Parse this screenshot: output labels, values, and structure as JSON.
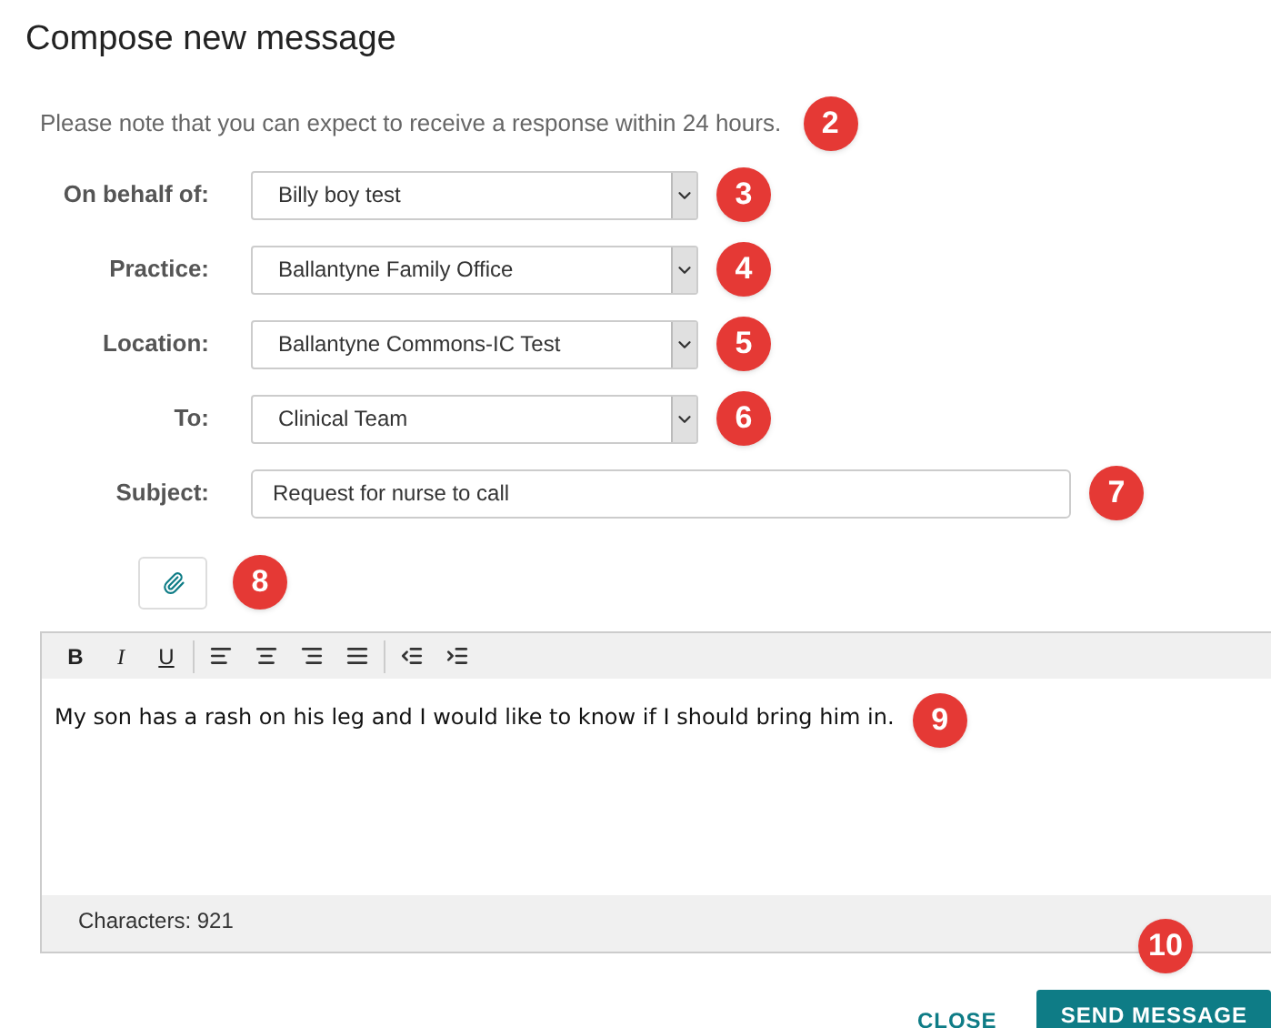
{
  "title": "Compose new message",
  "note": {
    "text": "Please note that you can expect to receive a response within 24 hours.",
    "badge": "2"
  },
  "fields": [
    {
      "kind": "select",
      "label": "On behalf of:",
      "value": "Billy boy test",
      "badge": "3"
    },
    {
      "kind": "select",
      "label": "Practice:",
      "value": "Ballantyne Family Office",
      "badge": "4"
    },
    {
      "kind": "select",
      "label": "Location:",
      "value": "Ballantyne Commons-IC Test",
      "badge": "5"
    },
    {
      "kind": "select",
      "label": "To:",
      "value": "Clinical Team",
      "badge": "6"
    },
    {
      "kind": "text",
      "label": "Subject:",
      "value": "Request for nurse to call",
      "badge": "7"
    }
  ],
  "attach": {
    "badge": "8"
  },
  "toolbar": [
    {
      "kind": "bold",
      "label": "B"
    },
    {
      "kind": "italic",
      "label": "I"
    },
    {
      "kind": "underline",
      "label": "U"
    },
    {
      "kind": "align-left"
    },
    {
      "kind": "align-center"
    },
    {
      "kind": "align-right"
    },
    {
      "kind": "align-justify"
    },
    {
      "kind": "outdent"
    },
    {
      "kind": "indent"
    }
  ],
  "editor": {
    "body": "My son has a rash on his leg and I would like to know if I should bring him in.",
    "badge": "9",
    "characters": "Characters: 921"
  },
  "buttons": [
    {
      "kind": "flat",
      "label": "CLOSE"
    },
    {
      "kind": "primary",
      "label": "SEND MESSAGE"
    }
  ],
  "footer_badge": "10"
}
